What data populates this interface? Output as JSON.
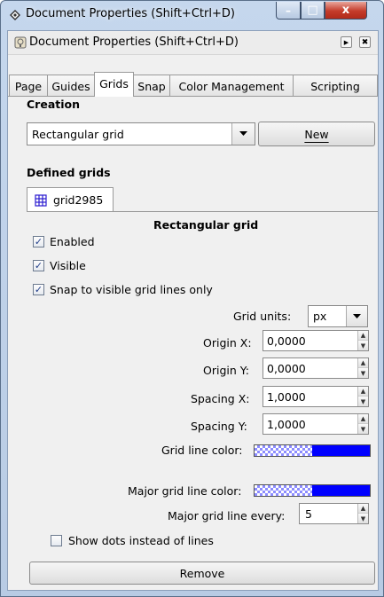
{
  "window": {
    "title": "Document Properties (Shift+Ctrl+D)",
    "minimize_glyph": "–",
    "maximize_glyph": "□",
    "close_glyph": "x"
  },
  "dock": {
    "title": "Document Properties (Shift+Ctrl+D)"
  },
  "tabs": [
    {
      "label": "Page"
    },
    {
      "label": "Guides"
    },
    {
      "label": "Grids"
    },
    {
      "label": "Snap"
    },
    {
      "label": "Color Management"
    },
    {
      "label": "Scripting"
    }
  ],
  "creation": {
    "heading": "Creation",
    "selected": "Rectangular grid",
    "new_button": "New"
  },
  "defined": {
    "heading": "Defined grids",
    "grid_tab": "grid2985"
  },
  "grid": {
    "type_heading": "Rectangular grid",
    "enabled_label": "Enabled",
    "visible_label": "Visible",
    "snap_label": "Snap to visible grid lines only",
    "units_label": "Grid units:",
    "units_value": "px",
    "origin_x_label": "Origin X:",
    "origin_x_value": "0,0000",
    "origin_y_label": "Origin Y:",
    "origin_y_value": "0,0000",
    "spacing_x_label": "Spacing X:",
    "spacing_x_value": "1,0000",
    "spacing_y_label": "Spacing Y:",
    "spacing_y_value": "1,0000",
    "line_color_label": "Grid line color:",
    "major_color_label": "Major grid line color:",
    "major_every_label": "Major grid line every:",
    "major_every_value": "5",
    "dots_label": "Show dots instead of lines",
    "remove_button": "Remove"
  },
  "colors": {
    "grid_line": "#0000ff",
    "major_grid_line": "#0000ff"
  }
}
